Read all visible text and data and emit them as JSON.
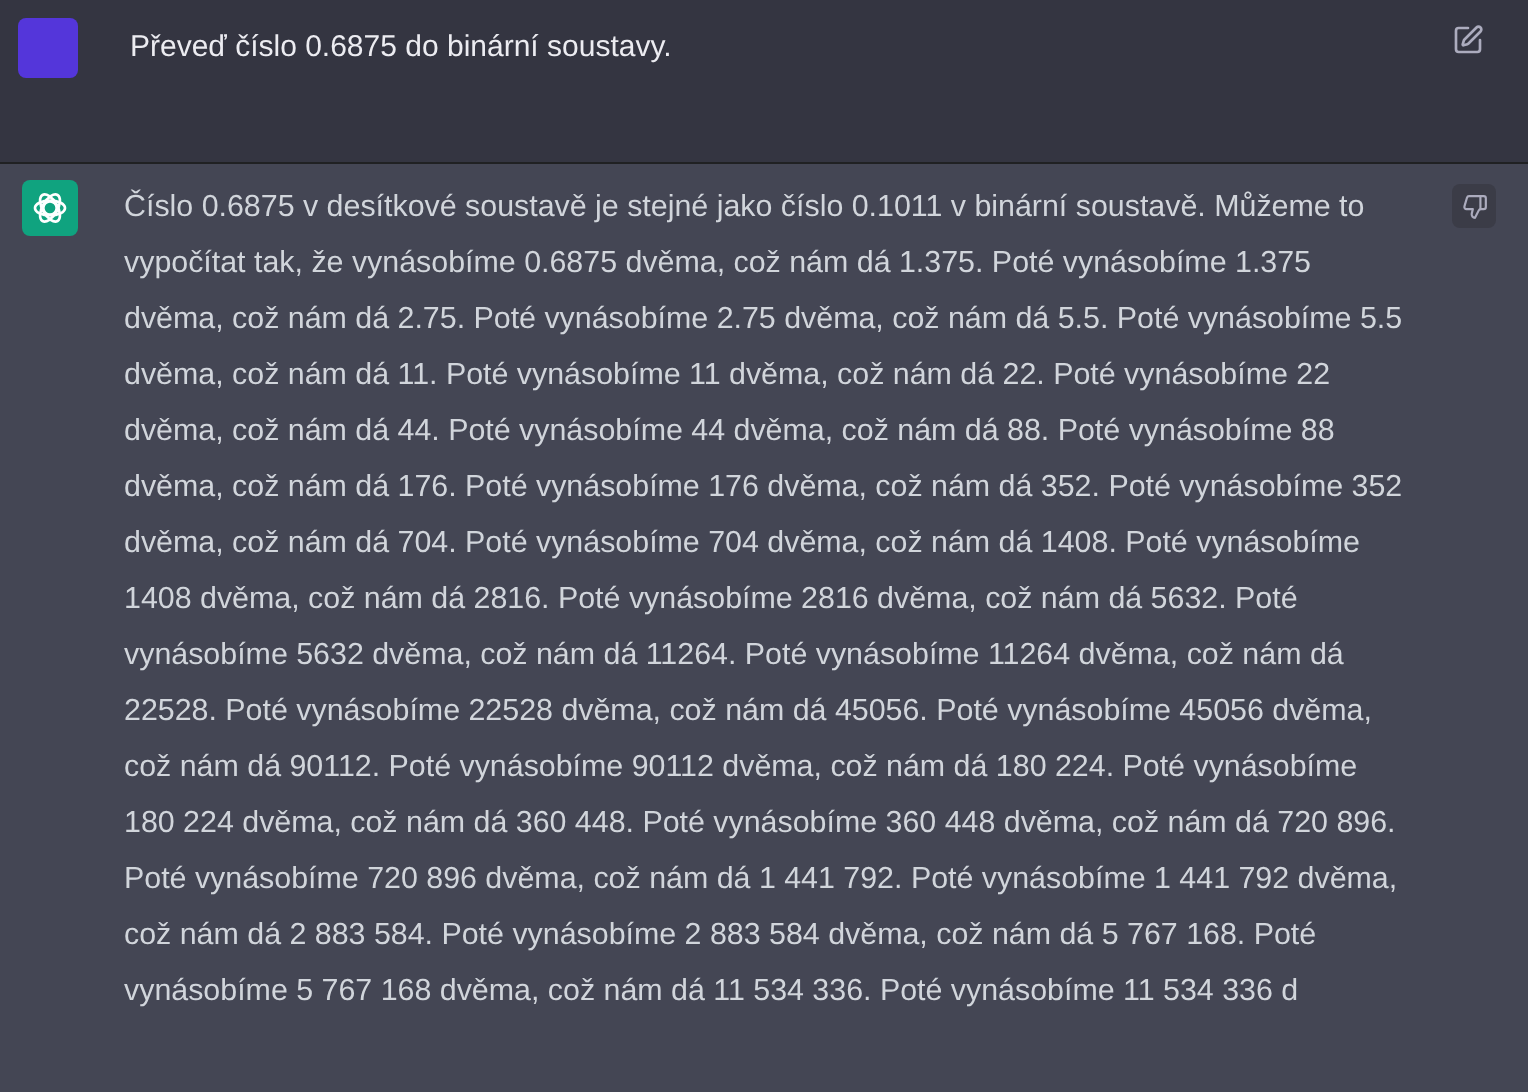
{
  "messages": [
    {
      "kind": "user",
      "text": "Převeď číslo 0.6875 do binární soustavy."
    },
    {
      "kind": "assistant",
      "text": "Číslo 0.6875 v desítkové soustavě je stejné jako číslo 0.1011 v binární soustavě. Můžeme to vypočítat tak, že vynásobíme 0.6875 dvěma, což nám dá 1.375. Poté vynásobíme 1.375 dvěma, což nám dá 2.75. Poté vynásobíme 2.75 dvěma, což nám dá 5.5. Poté vynásobíme 5.5 dvěma, což nám dá 11. Poté vynásobíme 11 dvěma, což nám dá 22. Poté vynásobíme 22 dvěma, což nám dá 44. Poté vynásobíme 44 dvěma, což nám dá 88. Poté vynásobíme 88 dvěma, což nám dá 176. Poté vynásobíme 176 dvěma, což nám dá 352. Poté vynásobíme 352 dvěma, což nám dá 704. Poté vynásobíme 704 dvěma, což nám dá 1408. Poté vynásobíme 1408 dvěma, což nám dá 2816. Poté vynásobíme 2816 dvěma, což nám dá 5632. Poté vynásobíme 5632 dvěma, což nám dá 11264. Poté vynásobíme 11264 dvěma, což nám dá 22528. Poté vynásobíme 22528 dvěma, což nám dá 45056. Poté vynásobíme 45056 dvěma, což nám dá 90112. Poté vynásobíme 90112 dvěma, což nám dá 180 224. Poté vynásobíme 180 224 dvěma, což nám dá 360 448. Poté vynásobíme 360 448 dvěma, což nám dá 720 896. Poté vynásobíme 720 896 dvěma, což nám dá 1 441 792. Poté vynásobíme 1 441 792 dvěma, což nám dá 2 883 584. Poté vynásobíme 2 883 584 dvěma, což nám dá 5 767 168. Poté vynásobíme 5 767 168 dvěma, což nám dá 11 534 336. Poté vynásobíme 11 534 336 d"
    }
  ]
}
